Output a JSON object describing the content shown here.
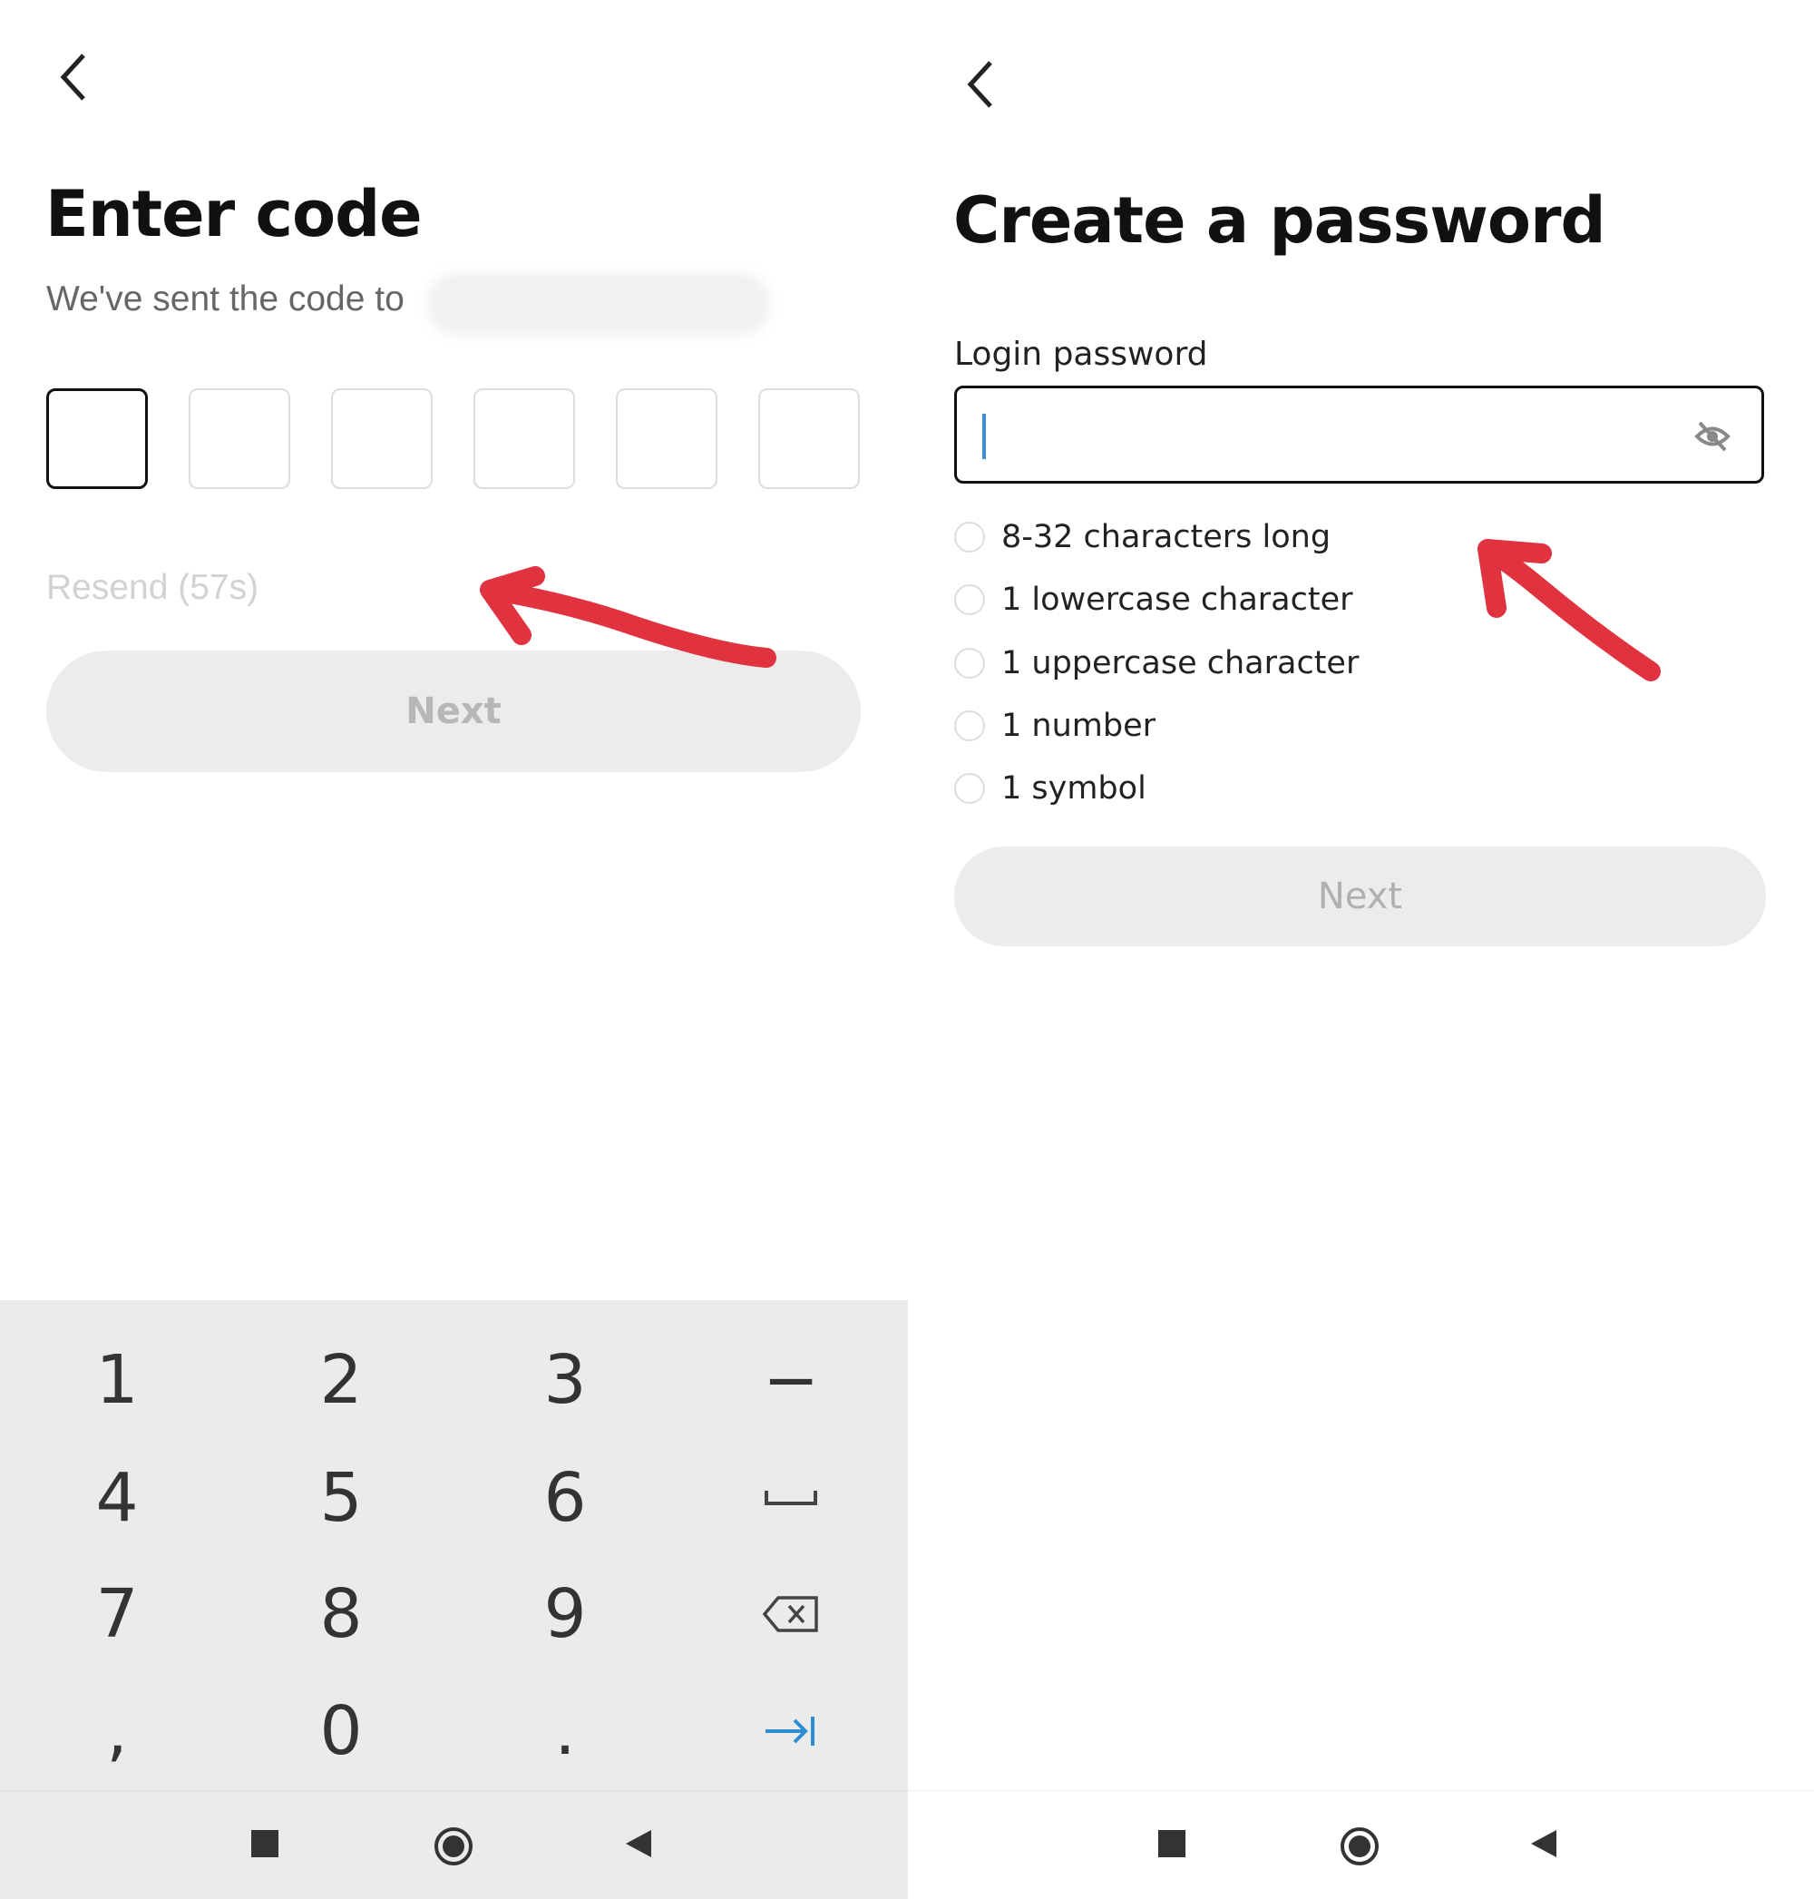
{
  "enter_code": {
    "title": "Enter code",
    "subtitle": "We've sent the code to",
    "code_boxes": [
      "",
      "",
      "",
      "",
      "",
      ""
    ],
    "resend": "Resend (57s)",
    "next": "Next"
  },
  "keyboard": {
    "rows": [
      [
        "1",
        "2",
        "3",
        "−"
      ],
      [
        "4",
        "5",
        "6",
        "space"
      ],
      [
        "7",
        "8",
        "9",
        "backspace"
      ],
      [
        ",",
        "0",
        ".",
        "tab"
      ]
    ]
  },
  "create_password": {
    "title": "Create a password",
    "label": "Login password",
    "value": "",
    "rules": [
      "8-32 characters long",
      "1 lowercase character",
      "1 uppercase character",
      "1 number",
      "1 symbol"
    ],
    "next": "Next"
  },
  "colors": {
    "annotation_arrow": "#e0333f",
    "caret": "#3a8fd8",
    "tab_key": "#2d8fd0",
    "disabled_button": "#ececec"
  }
}
